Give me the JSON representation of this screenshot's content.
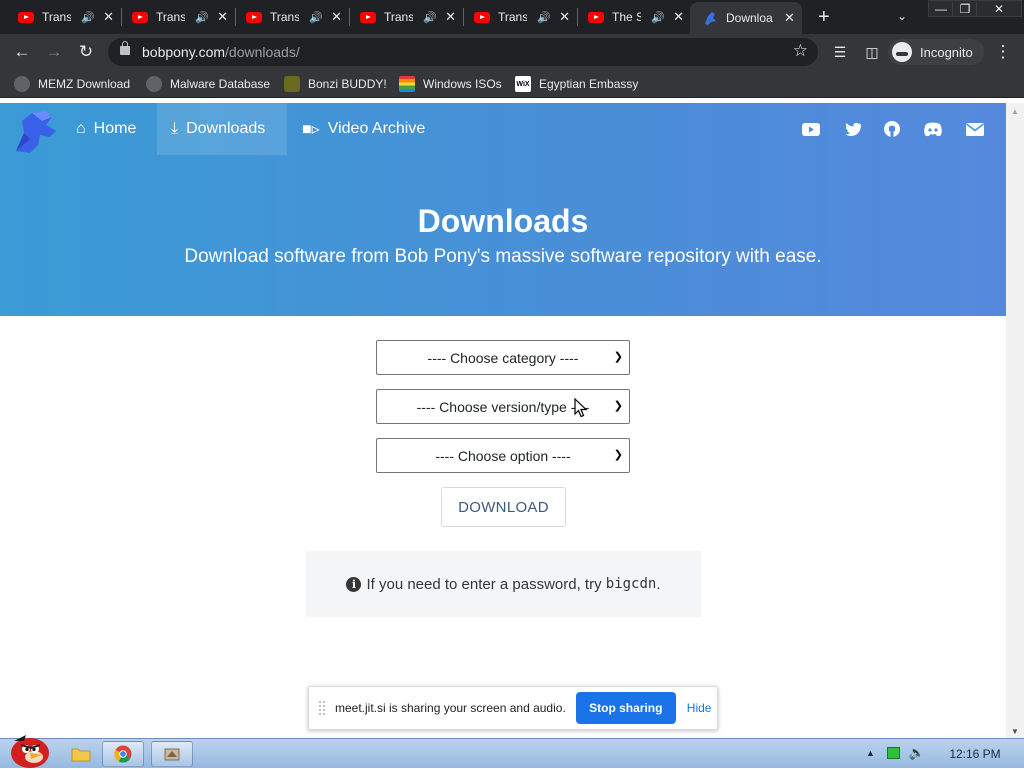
{
  "browser": {
    "tabs": [
      {
        "title": "Trans",
        "favicon": "youtube-icon",
        "audio": true
      },
      {
        "title": "Trans",
        "favicon": "youtube-icon",
        "audio": true
      },
      {
        "title": "Trans",
        "favicon": "youtube-icon",
        "audio": true
      },
      {
        "title": "Trans",
        "favicon": "youtube-icon",
        "audio": true
      },
      {
        "title": "Trans",
        "favicon": "youtube-icon",
        "audio": true
      },
      {
        "title": "The S",
        "favicon": "youtube-icon",
        "audio": true
      },
      {
        "title": "Downloa",
        "favicon": "bobpony-icon",
        "active": true
      }
    ],
    "url_host": "bobpony.com",
    "url_path": "/downloads/",
    "profile_label": "Incognito",
    "bookmarks": [
      {
        "label": "MEMZ Download",
        "icon": "globe-icon"
      },
      {
        "label": "Malware Database",
        "icon": "globe-icon"
      },
      {
        "label": "Bonzi BUDDY!",
        "icon": "bonzi-icon"
      },
      {
        "label": "Windows ISOs",
        "icon": "windows-flag-icon"
      },
      {
        "label": "Egyptian Embassy",
        "icon": "wix-icon",
        "icon_text": "WiX"
      }
    ]
  },
  "site": {
    "nav": [
      {
        "label": "Home",
        "icon": "home-icon"
      },
      {
        "label": "Downloads",
        "icon": "download-icon",
        "active": true
      },
      {
        "label": "Video Archive",
        "icon": "video-camera-icon"
      }
    ],
    "social_icons": [
      "youtube-icon",
      "twitter-icon",
      "github-icon",
      "discord-icon",
      "email-icon"
    ],
    "hero_title": "Downloads",
    "hero_subtitle": "Download software from Bob Pony's massive software repository with ease.",
    "selects": {
      "category": "---- Choose category ----",
      "version": "---- Choose version/type ----",
      "option": "---- Choose option ----"
    },
    "download_label": "DOWNLOAD",
    "notice_text": "If you need to enter a password, try ",
    "notice_code": "bigcdn",
    "notice_end": "."
  },
  "share_bar": {
    "message": "meet.jit.si is sharing your screen and audio.",
    "stop_label": "Stop sharing",
    "hide_label": "Hide"
  },
  "taskbar": {
    "clock": "12:16 PM"
  },
  "colors": {
    "hero_gradient_start": "#3a9bd5",
    "hero_gradient_end": "#5689dd",
    "share_button": "#1a73e8",
    "youtube_red": "#ff0000"
  }
}
